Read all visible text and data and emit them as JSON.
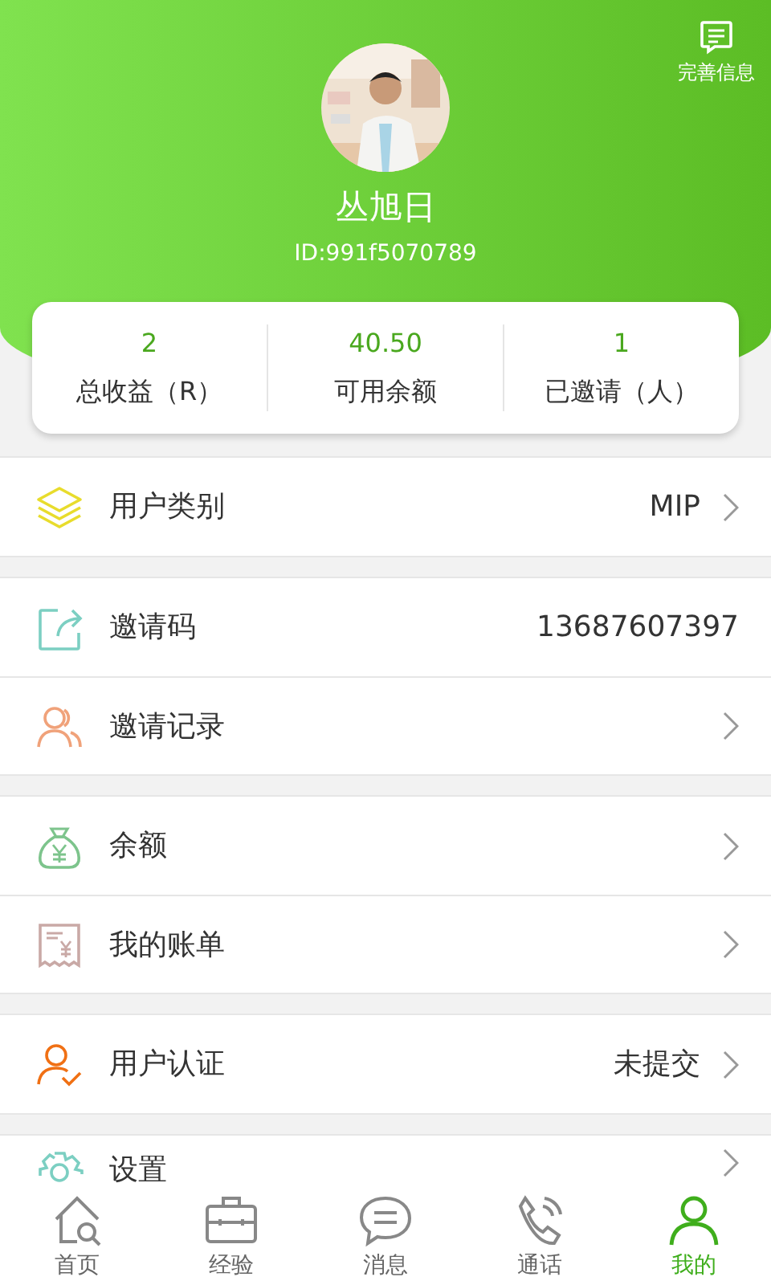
{
  "header": {
    "action": "完善信息",
    "name": "丛旭日",
    "user_id": "ID:991f5070789"
  },
  "stats": [
    {
      "value": "2",
      "label": "总收益（R）"
    },
    {
      "value": "40.50",
      "label": "可用余额"
    },
    {
      "value": "1",
      "label": "已邀请（人）"
    }
  ],
  "groups": [
    [
      {
        "label": "用户类别",
        "value": "MIP",
        "has_arrow": true
      }
    ],
    [
      {
        "label": "邀请码",
        "value": "13687607397",
        "has_arrow": false
      },
      {
        "label": "邀请记录",
        "has_arrow": true
      }
    ],
    [
      {
        "label": "余额",
        "has_arrow": true
      },
      {
        "label": "我的账单",
        "has_arrow": true
      }
    ],
    [
      {
        "label": "用户认证",
        "value": "未提交",
        "has_arrow": true
      }
    ],
    [
      {
        "label": "设置",
        "has_arrow": true
      }
    ]
  ],
  "tabs": [
    {
      "label": "首页",
      "selected": false
    },
    {
      "label": "经验",
      "selected": false
    },
    {
      "label": "消息",
      "selected": false
    },
    {
      "label": "通话",
      "selected": false
    },
    {
      "label": "我的",
      "selected": true
    }
  ]
}
